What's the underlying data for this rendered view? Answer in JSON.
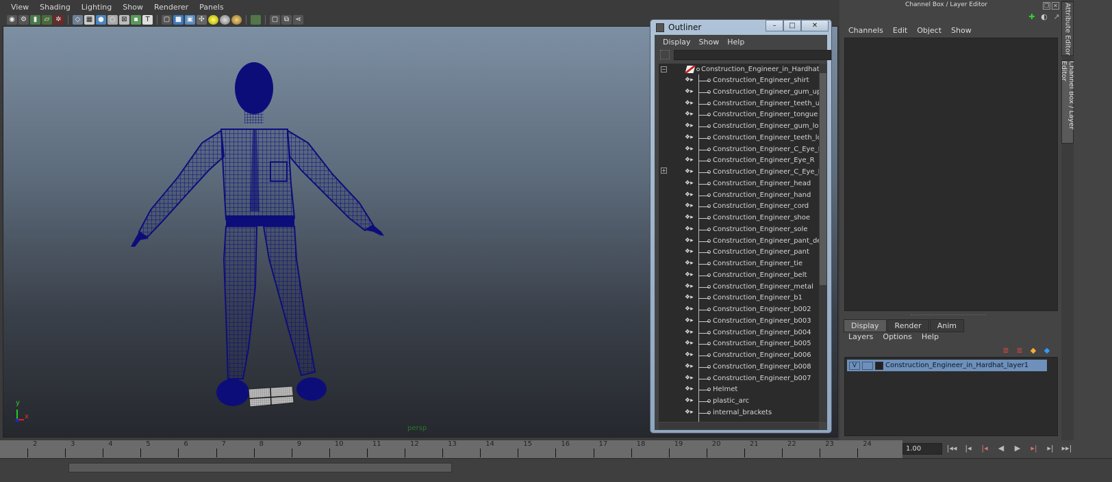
{
  "viewport": {
    "menu": [
      "View",
      "Shading",
      "Lighting",
      "Show",
      "Renderer",
      "Panels"
    ],
    "camera_label": "persp",
    "axis": {
      "y": "y",
      "x": "x"
    },
    "toolbar_icons": [
      "camera-select-icon",
      "camera-attributes-icon",
      "bookmark-icon",
      "image-plane-icon",
      "2d-pan-zoom-icon",
      "grid-icon",
      "film-gate-icon",
      "resolution-gate-icon",
      "gate-mask-icon",
      "field-chart-icon",
      "safe-action-icon",
      "safe-title-icon",
      "wireframe-icon",
      "smooth-shade-icon",
      "wireframe-on-shaded-icon",
      "textured-icon",
      "lights-icon",
      "shadows-icon",
      "ambient-occlusion-icon",
      "isolate-select-icon",
      "xray-icon",
      "xray-joints-icon",
      "xray-components-icon"
    ]
  },
  "timeline": {
    "ticks": [
      "2",
      "3",
      "4",
      "5",
      "6",
      "7",
      "8",
      "9",
      "10",
      "11",
      "12",
      "13",
      "14",
      "15",
      "16",
      "17",
      "18",
      "19",
      "20",
      "21",
      "22",
      "23",
      "24"
    ],
    "current_frame": "1.00",
    "playback_buttons": [
      "go-to-start",
      "step-back-frame",
      "step-back-key",
      "play-backwards",
      "play-forwards",
      "step-forward-key",
      "step-forward-frame",
      "go-to-end"
    ]
  },
  "outliner": {
    "title": "Outliner",
    "menu": [
      "Display",
      "Show",
      "Help"
    ],
    "filter_value": "",
    "root": "Construction_Engineer_in_Hardhat",
    "items": [
      "Construction_Engineer_shirt",
      "Construction_Engineer_gum_upper",
      "Construction_Engineer_teeth_upper",
      "Construction_Engineer_tongue",
      "Construction_Engineer_gum_lower",
      "Construction_Engineer_teeth_lower",
      "Construction_Engineer_C_Eye_R",
      "Construction_Engineer_Eye_R",
      "Construction_Engineer_C_Eye_L",
      "Construction_Engineer_head",
      "Construction_Engineer_hand",
      "Construction_Engineer_cord",
      "Construction_Engineer_shoe",
      "Construction_Engineer_sole",
      "Construction_Engineer_pant_detail",
      "Construction_Engineer_pant",
      "Construction_Engineer_tie",
      "Construction_Engineer_belt",
      "Construction_Engineer_metal",
      "Construction_Engineer_b1",
      "Construction_Engineer_b002",
      "Construction_Engineer_b003",
      "Construction_Engineer_b004",
      "Construction_Engineer_b005",
      "Construction_Engineer_b006",
      "Construction_Engineer_b008",
      "Construction_Engineer_b007",
      "Helmet",
      "plastic_arc",
      "internal_brackets"
    ],
    "window_buttons": {
      "minimize": "–",
      "maximize": "□",
      "close": "✕"
    }
  },
  "channel_box": {
    "title": "Channel Box / Layer Editor",
    "menu": [
      "Channels",
      "Edit",
      "Object",
      "Show"
    ]
  },
  "layer_editor": {
    "tabs": [
      "Display",
      "Render",
      "Anim"
    ],
    "active_tab": "Display",
    "menu": [
      "Layers",
      "Options",
      "Help"
    ],
    "layers": [
      {
        "visible": "V",
        "playback": "",
        "name": "Construction_Engineer_in_Hardhat_layer1"
      }
    ]
  },
  "side_tabs": [
    "Attribute Editor",
    "Channel Box / Layer Editor"
  ],
  "colors": {
    "wireframe": "#0d0d7a",
    "layer_selected": "#6e90ba",
    "panel_bg": "#444444",
    "field_bg": "#2b2b2b"
  }
}
